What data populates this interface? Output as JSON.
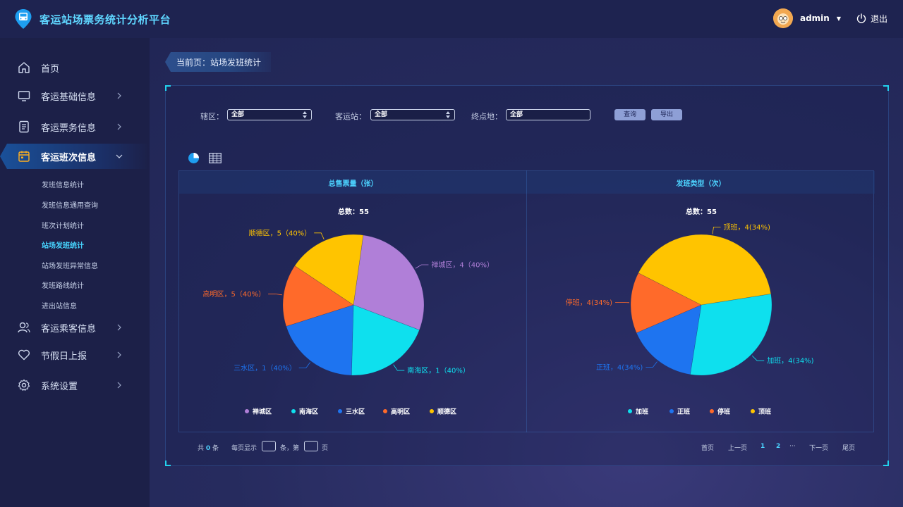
{
  "app": {
    "title": "客运站场票务统计分析平台"
  },
  "header": {
    "user": "admin",
    "logout": "退出"
  },
  "sidebar": {
    "items": [
      {
        "label": "首页"
      },
      {
        "label": "客运基础信息"
      },
      {
        "label": "客运票务信息"
      },
      {
        "label": "客运班次信息"
      },
      {
        "label": "客运乘客信息"
      },
      {
        "label": "节假日上报"
      },
      {
        "label": "系统设置"
      }
    ],
    "sub_items": [
      {
        "label": "发班信息统计"
      },
      {
        "label": "发班信息通用查询"
      },
      {
        "label": "班次计划统计"
      },
      {
        "label": "站场发班统计"
      },
      {
        "label": "站场发班异常信息"
      },
      {
        "label": "发班路线统计"
      },
      {
        "label": "进出站信息"
      }
    ]
  },
  "breadcrumb": "当前页：站场发班统计",
  "filters": {
    "district_label": "辖区：",
    "district_value": "全部",
    "station_label": "客运站：",
    "station_value": "全部",
    "destination_label": "终点地：",
    "destination_value": "全部",
    "query_label": "查询",
    "export_label": "导出"
  },
  "pagination": {
    "total_prefix": "共",
    "total_count": "0",
    "total_suffix": "条",
    "per_page_prefix": "每页显示",
    "per_page_mid": "条，第",
    "per_page_suffix": "页",
    "first": "首页",
    "prev": "上一页",
    "page1": "1",
    "page2": "2",
    "ellipsis": "···",
    "next": "下一页",
    "last": "尾页"
  },
  "chart_data": [
    {
      "type": "pie",
      "title": "总售票量（张）",
      "subtitle": "总数：55",
      "slices": [
        {
          "name": "禅城区",
          "value": 16,
          "label": "禅城区，4（40%）",
          "color": "#b07fd8"
        },
        {
          "name": "南海区",
          "value": 11,
          "label": "南海区，1（40%）",
          "color": "#0ee0ee"
        },
        {
          "name": "三水区",
          "value": 11,
          "label": "三水区，1（40%）",
          "color": "#1e74f0"
        },
        {
          "name": "高明区",
          "value": 8,
          "label": "高明区，5（40%）",
          "color": "#ff6a2a"
        },
        {
          "name": "顺德区",
          "value": 10,
          "label": "顺德区，5（40%）",
          "color": "#ffc400"
        }
      ],
      "legend": [
        "禅城区",
        "南海区",
        "三水区",
        "高明区",
        "顺德区"
      ],
      "legend_position": "bottom"
    },
    {
      "type": "pie",
      "title": "发班类型（次）",
      "subtitle": "总数：55",
      "slices": [
        {
          "name": "加班",
          "value": 30,
          "label": "加班，4(34%)",
          "color": "#0ee0ee"
        },
        {
          "name": "正班",
          "value": 16,
          "label": "正班，4(34%)",
          "color": "#1e74f0"
        },
        {
          "name": "停班",
          "value": 14,
          "label": "停班，4(34%)",
          "color": "#ff6a2a"
        },
        {
          "name": "顶班",
          "value": 40,
          "label": "顶班，4(34%)",
          "color": "#ffc400"
        }
      ],
      "legend": [
        "加班",
        "正班",
        "停班",
        "顶班"
      ],
      "legend_position": "bottom"
    }
  ]
}
